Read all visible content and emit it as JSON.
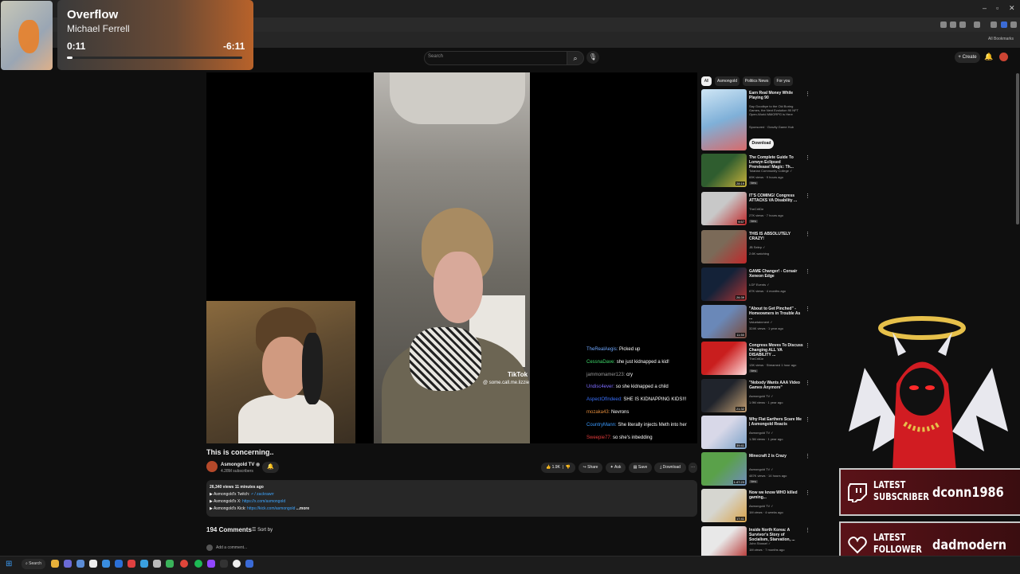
{
  "music": {
    "title": "Overflow",
    "artist": "Michael Ferrell",
    "elapsed": "0:11",
    "remaining": "-6:11",
    "progress_fraction": 0.03
  },
  "browser": {
    "minimize": "–",
    "maximize": "▫",
    "close": "✕",
    "bookmarks_label": "All Bookmarks"
  },
  "header": {
    "search_placeholder": "Search",
    "search_icon": "search-icon",
    "mic_icon": "mic-icon",
    "create_label": "+ Create",
    "bell_icon": "bell-icon"
  },
  "video": {
    "title": "This is concerning..",
    "channel": "Asmongold TV",
    "verified": "◉",
    "subscribers": "4.28M subscribers",
    "tiktok_brand": "TikTok",
    "tiktok_handle": "@ some.call.me.lizzie",
    "actions": {
      "like": "1.9K",
      "share": "Share",
      "ask": "Ask",
      "save": "Save",
      "download": "Download",
      "more": "···"
    },
    "description": {
      "stats": "26,340 views  11 minutes ago",
      "twitch_label": "▶ Asmongold's Twitch: ",
      "twitch_link": "🗲 / zackrawrr",
      "x_label": "▶ Asmongold's X: ",
      "x_link": "https://x.com/asmongold",
      "kick_label": "▶ Asmongold's Kick: ",
      "kick_link": "https://kick.com/asmongold",
      "more": "...more"
    },
    "comments_count": "194 Comments",
    "sort_by": "Sort by",
    "add_comment": "Add a comment..."
  },
  "chat": [
    {
      "user": "TheRealAegis:",
      "color": "#6fa8ff",
      "msg": "Picked up"
    },
    {
      "user": "CessnaDave:",
      "color": "#3fd96b",
      "msg": "she just kidnapped a kid!"
    },
    {
      "user": "jammomamer123:",
      "color": "#9a9a9a",
      "msg": "cry"
    },
    {
      "user": "Undisc4ever:",
      "color": "#7d6cff",
      "msg": "so she kidnapped a child"
    },
    {
      "user": "AspectOfIndeed:",
      "color": "#3a72ff",
      "msg": "SHE IS KIDNAPPING KIDS!!!"
    },
    {
      "user": "mozaka43:",
      "color": "#e08a3a",
      "msg": "Nevrons"
    },
    {
      "user": "CountryMann:",
      "color": "#3a9bff",
      "msg": "She literally injects Meth into her"
    },
    {
      "user": "Sweepie77:",
      "color": "#e33b3b",
      "msg": "so she's inbedding"
    }
  ],
  "chips": [
    "All",
    "Asmongold",
    "Politics News",
    "For you"
  ],
  "ad": {
    "title": "Earn Real Money While Playing 90",
    "body": "Say Goodbye to the Old Boring Games, the Next Evolution 90 NFT Open-World MMORPG is Here",
    "sponsored": "Sponsored · Gravity Game Hub",
    "cta": "Download"
  },
  "recommendations": [
    {
      "title": "The Complete Guide To Lorwyn Eclipsed Prerelease! Magic: Th...",
      "channel": "Tolarian Community College ✓",
      "meta": "69K views · 9 hours ago",
      "badge": "New",
      "duration": "28:19",
      "c1": "#2f5d2f",
      "c2": "#c9b23a"
    },
    {
      "title": "IT'S COMING! Congress ATTACKS VA Disability ...",
      "channel": "TheCritDe",
      "meta": "27K views · 7 hours ago",
      "badge": "New",
      "duration": "9:57",
      "c1": "#c8c8c8",
      "c2": "#c0282a"
    },
    {
      "title": "THIS IS ABSOLUTELY CRAZY!",
      "channel": "JB Selep ✓",
      "meta": "2.6K watching",
      "badge": "",
      "duration": "",
      "c1": "#7b6a58",
      "c2": "#c0282a"
    },
    {
      "title": "GAME Changer! - Corsair Xeneon Edge",
      "channel": "LGF Events ✓",
      "meta": "87K views · 4 months ago",
      "badge": "",
      "duration": "26:39",
      "c1": "#142238",
      "c2": "#a33"
    },
    {
      "title": "\"About to Get Pinched\" - Homeowners in Trouble As ...",
      "channel": "Valuetainment ✓",
      "meta": "324K views · 1 year ago",
      "badge": "",
      "duration": "11:50",
      "c1": "#6a88b8",
      "c2": "#7a4a3a"
    },
    {
      "title": "Congress Moves To Discuss Changing ALL VA DISABILITY ...",
      "channel": "TheCritDe",
      "meta": "13K views · Streamed 1 hour ago",
      "badge": "New",
      "duration": "",
      "c1": "#c91e1e",
      "c2": "#ffdcdc"
    },
    {
      "title": "\"Nobody Wants AAA Video Games Anymore\"",
      "channel": "Asmongold TV ✓",
      "meta": "1.9M views · 1 year ago",
      "badge": "",
      "duration": "21:32",
      "c1": "#20242c",
      "c2": "#c5a073"
    },
    {
      "title": "Why Flat Earthers Scare Me | Asmongold Reacts",
      "channel": "Asmongold TV ✓",
      "meta": "1.3M views · 1 year ago",
      "badge": "",
      "duration": "39:41",
      "c1": "#d8d8e8",
      "c2": "#7aa0c8"
    },
    {
      "title": "Minecraft 2 is Crazy",
      "channel": "Asmongold TV ✓",
      "meta": "487K views · 14 hours ago",
      "badge": "New",
      "duration": "1:47:23",
      "c1": "#5aa14a",
      "c2": "#6f8bbd"
    },
    {
      "title": "Now we know WHO killed gaming...",
      "channel": "Asmongold TV ✓",
      "meta": "1M views · 4 weeks ago",
      "badge": "",
      "duration": "17:41",
      "c1": "#d6d6d0",
      "c2": "#d8a34a"
    },
    {
      "title": "Inside North Korea: A Survivor's Story of Socialism, Starvation, ...",
      "channel": "John Stossel ✓",
      "meta": "1M views · 7 months ago",
      "badge": "",
      "duration": "",
      "c1": "#e8e8e8",
      "c2": "#b5302e"
    }
  ],
  "overlay": {
    "latest_subscriber_label_1": "LATEST",
    "latest_subscriber_label_2": "SUBSCRIBER",
    "latest_subscriber_name": "dconn1986",
    "latest_follower_label_1": "LATEST",
    "latest_follower_label_2": "FOLLOWER",
    "latest_follower_name": "dadmodern"
  },
  "taskbar": {
    "start_icon": "windows-start-icon",
    "search_label": "Search"
  }
}
